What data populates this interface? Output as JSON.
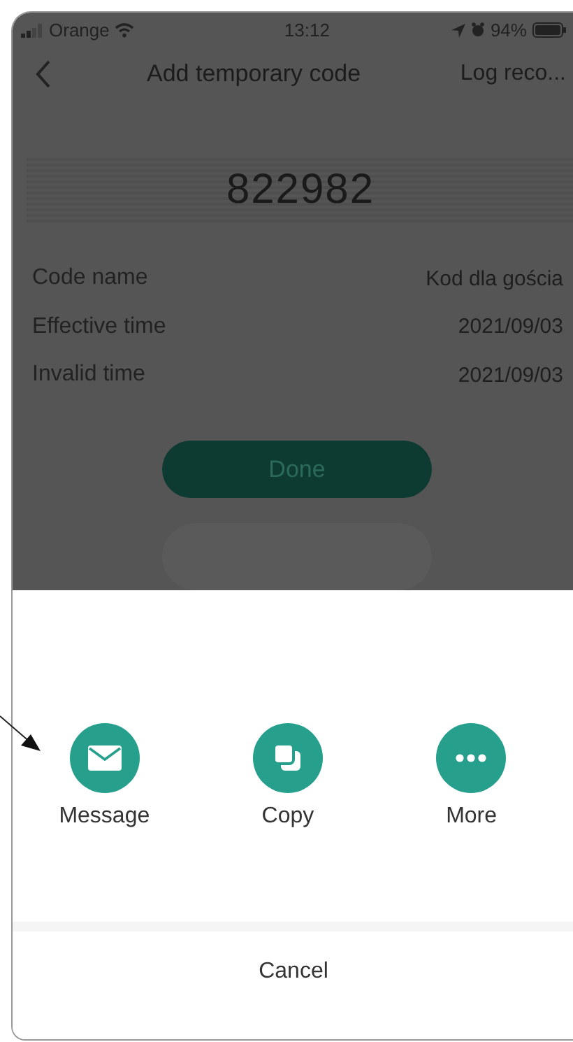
{
  "status_bar": {
    "carrier": "Orange",
    "time": "13:12",
    "battery": "94%"
  },
  "nav": {
    "title": "Add temporary code",
    "action": "Log reco..."
  },
  "code": "822982",
  "details": [
    {
      "label": "Code name",
      "value": "Kod dla gościa"
    },
    {
      "label": "Effective time",
      "value": "2021/09/03"
    },
    {
      "label": "Invalid time",
      "value": "2021/09/03"
    }
  ],
  "done_button": "Done",
  "share_sheet": {
    "options": [
      {
        "kind": "message",
        "label": "Message"
      },
      {
        "kind": "copy",
        "label": "Copy"
      },
      {
        "kind": "more",
        "label": "More"
      }
    ],
    "cancel": "Cancel"
  }
}
